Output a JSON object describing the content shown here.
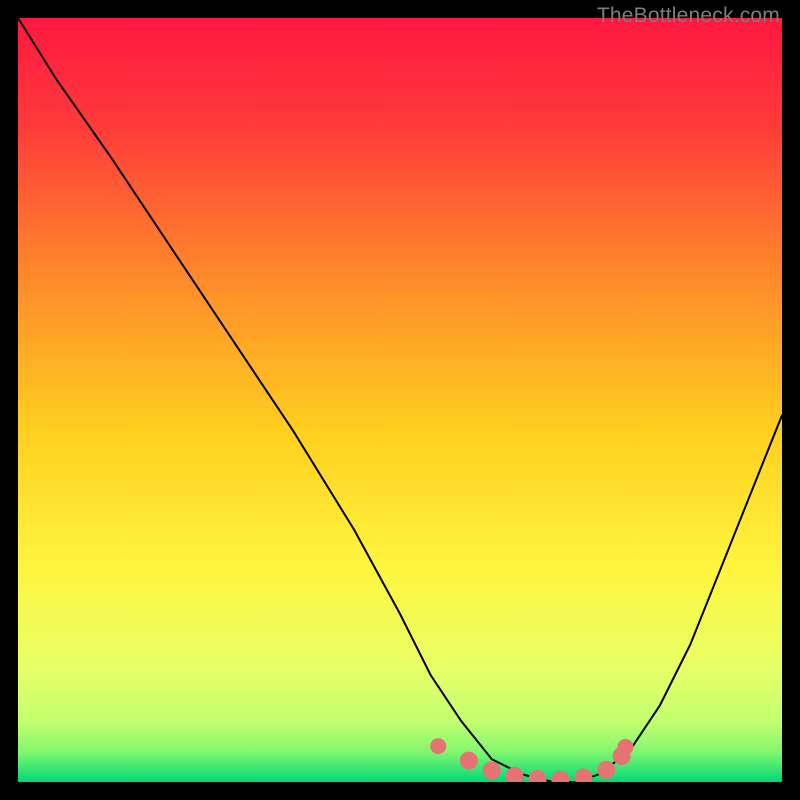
{
  "watermark": "TheBottleneck.com",
  "colors": {
    "frame": "#000000",
    "gradient_top": "#ff1e3e",
    "gradient_mid": "#ffd600",
    "gradient_low": "#f7ff6a",
    "gradient_bottom": "#00d977",
    "curve": "#000000",
    "dots": "#e57373"
  },
  "chart_data": {
    "type": "line",
    "title": "",
    "xlabel": "",
    "ylabel": "",
    "xlim": [
      0,
      100
    ],
    "ylim": [
      0,
      100
    ],
    "series": [
      {
        "name": "bottleneck-curve",
        "x": [
          0,
          5,
          12,
          20,
          28,
          36,
          44,
          50,
          54,
          58,
          62,
          66,
          70,
          73,
          76,
          80,
          84,
          88,
          92,
          96,
          100
        ],
        "y": [
          100,
          92,
          82,
          70,
          58,
          46,
          33,
          22,
          14,
          8,
          3,
          1,
          0,
          0,
          1,
          4,
          10,
          18,
          28,
          38,
          48
        ]
      }
    ],
    "markers": {
      "name": "highlight-range",
      "x": [
        55,
        59,
        62,
        65,
        68,
        71,
        74,
        77,
        79,
        79.5
      ],
      "y": [
        4.7,
        2.8,
        1.5,
        0.8,
        0.4,
        0.3,
        0.6,
        1.6,
        3.4,
        4.6
      ]
    },
    "annotations": []
  }
}
